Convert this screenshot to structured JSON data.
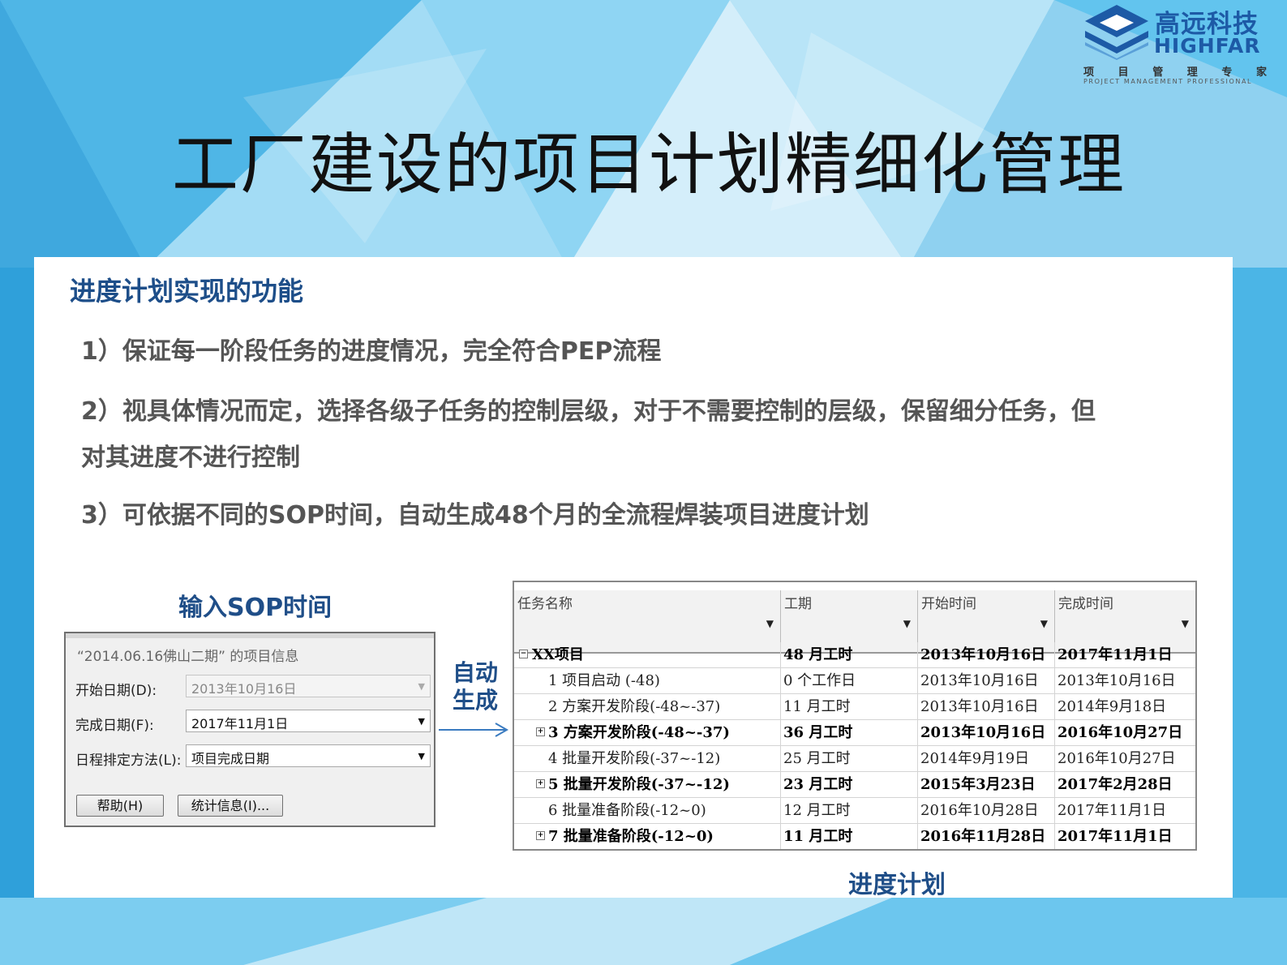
{
  "logo": {
    "name_cn": "高远科技",
    "name_en": "HIGHFAR",
    "tagline_cn": [
      "项",
      "目",
      "管",
      "理",
      "专",
      "家"
    ],
    "tagline_en": "PROJECT MANAGEMENT PROFESSIONAL",
    "color": "#1d5aa6"
  },
  "title": "工厂建设的项目计划精细化管理",
  "section": {
    "heading": "进度计划实现的功能",
    "points": [
      "1）保证每一阶段任务的进度情况，完全符合PEP流程",
      "2）视具体情况而定，选择各级子任务的控制层级，对于不需要控制的层级，保留细分任务，但",
      "对其进度不进行控制",
      "3）可依据不同的SOP时间，自动生成48个月的全流程焊装项目进度计划"
    ]
  },
  "input_caption": "输入SOP时间",
  "dialog": {
    "title": "“2014.06.16佛山二期” 的项目信息",
    "fields": [
      {
        "label": "开始日期(D):",
        "value": "2013年10月16日",
        "disabled": true
      },
      {
        "label": "完成日期(F):",
        "value": "2017年11月1日",
        "disabled": false
      },
      {
        "label": "日程排定方法(L):",
        "value": "项目完成日期",
        "disabled": false
      }
    ],
    "help_button": "帮助(H)",
    "stats_button": "统计信息(I)..."
  },
  "auto_generate_label": [
    "自动",
    "生成"
  ],
  "schedule": {
    "columns": [
      "任务名称",
      "工期",
      "开始时间",
      "完成时间"
    ],
    "rows": [
      {
        "level": 0,
        "expander": "−",
        "bold": true,
        "name": "XX项目",
        "duration": "48 月工时",
        "start": "2013年10月16日",
        "finish": "2017年11月1日"
      },
      {
        "level": 1,
        "expander": "",
        "bold": false,
        "name": "1 项目启动 (-48)",
        "duration": "0 个工作日",
        "start": "2013年10月16日",
        "finish": "2013年10月16日"
      },
      {
        "level": 1,
        "expander": "",
        "bold": false,
        "name": "2 方案开发阶段(-48~-37)",
        "duration": "11 月工时",
        "start": "2013年10月16日",
        "finish": "2014年9月18日"
      },
      {
        "level": 1,
        "expander": "+",
        "bold": true,
        "name": "3 方案开发阶段(-48~-37)",
        "duration": "36 月工时",
        "start": "2013年10月16日",
        "finish": "2016年10月27日"
      },
      {
        "level": 1,
        "expander": "",
        "bold": false,
        "name": "4 批量开发阶段(-37~-12)",
        "duration": "25 月工时",
        "start": "2014年9月19日",
        "finish": "2016年10月27日"
      },
      {
        "level": 1,
        "expander": "+",
        "bold": true,
        "name": "5 批量开发阶段(-37~-12)",
        "duration": "23 月工时",
        "start": "2015年3月23日",
        "finish": "2017年2月28日"
      },
      {
        "level": 1,
        "expander": "",
        "bold": false,
        "name": "6 批量准备阶段(-12~0)",
        "duration": "12 月工时",
        "start": "2016年10月28日",
        "finish": "2017年11月1日"
      },
      {
        "level": 1,
        "expander": "+",
        "bold": true,
        "name": "7 批量准备阶段(-12~0)",
        "duration": "11 月工时",
        "start": "2016年11月28日",
        "finish": "2017年11月1日"
      }
    ]
  },
  "schedule_caption": "进度计划",
  "colors": {
    "accent_blue": "#1d4e89",
    "panel_bg": "#ffffff",
    "background": "#5ec3ee"
  }
}
